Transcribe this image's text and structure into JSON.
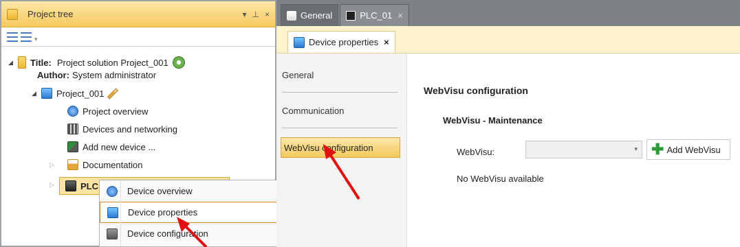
{
  "tree": {
    "title": "Project tree",
    "ctrl_pin": "▾ ⊥ ×",
    "title_label": "Title:",
    "title_value": "Project solution Project_001",
    "author_label": "Author:",
    "author_value": "System administrator",
    "project": "Project_001",
    "items": [
      "Project overview",
      "Devices and networking",
      "Add new device ...",
      "Documentation"
    ],
    "plc": "PLC"
  },
  "context_menu": {
    "items": [
      "Device overview",
      "Device properties",
      "Device configuration"
    ]
  },
  "tabs": [
    "General",
    "PLC_01"
  ],
  "subtab": "Device properties",
  "nav": {
    "items": [
      "General",
      "Communication",
      "WebVisu configuration"
    ]
  },
  "content": {
    "title": "WebVisu configuration",
    "maintenance_title": "WebVisu - Maintenance",
    "webvisu_label": "WebVisu:",
    "add_button": "Add WebVisu",
    "empty_message": "No WebVisu available"
  }
}
